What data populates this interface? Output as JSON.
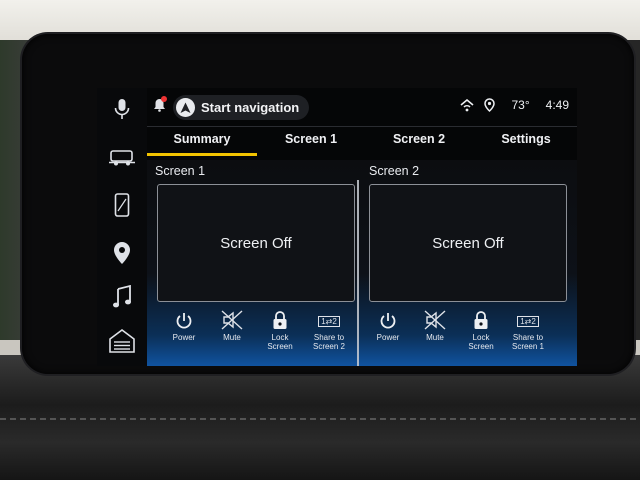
{
  "status": {
    "nav_label": "Start navigation",
    "temperature": "73°",
    "time": "4:49"
  },
  "tabs": [
    "Summary",
    "Screen 1",
    "Screen 2",
    "Settings"
  ],
  "active_tab": "Summary",
  "panels": [
    {
      "title": "Screen 1",
      "state": "Screen Off",
      "controls": [
        "Power",
        "Mute",
        "Lock Screen",
        "Share to Screen 2"
      ]
    },
    {
      "title": "Screen 2",
      "state": "Screen Off",
      "controls": [
        "Power",
        "Mute",
        "Lock Screen",
        "Share to Screen 1"
      ]
    }
  ],
  "share_icon_text": "1⇄2",
  "rail_icons": [
    "microphone-icon",
    "vehicle-icon",
    "phone-icon",
    "location-pin-icon",
    "music-note-icon",
    "garage-home-icon"
  ],
  "colors": {
    "accent": "#f2c300",
    "gradient_blue": "#1053a0"
  }
}
